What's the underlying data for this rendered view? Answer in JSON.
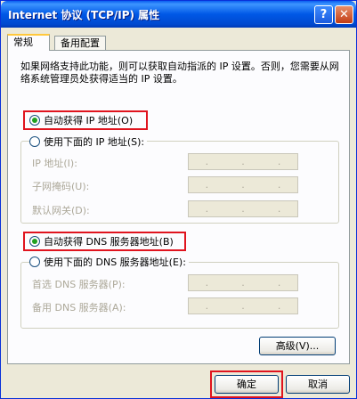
{
  "window": {
    "title": "Internet 协议 (TCP/IP) 属性",
    "help_glyph": "?",
    "close_glyph": "✕"
  },
  "tabs": [
    {
      "label": "常规",
      "active": true
    },
    {
      "label": "备用配置",
      "active": false
    }
  ],
  "description": "如果网络支持此功能，则可以获取自动指派的 IP 设置。否则，您需要从网络系统管理员处获得适当的 IP 设置。",
  "ip_section": {
    "auto_option": "自动获得 IP 地址(O)",
    "manual_option": "使用下面的 IP 地址(S):",
    "selected": "auto",
    "fields": [
      {
        "label": "IP 地址(I):"
      },
      {
        "label": "子网掩码(U):"
      },
      {
        "label": "默认网关(D):"
      }
    ]
  },
  "dns_section": {
    "auto_option": "自动获得 DNS 服务器地址(B)",
    "manual_option": "使用下面的 DNS 服务器地址(E):",
    "selected": "auto",
    "fields": [
      {
        "label": "首选 DNS 服务器(P):"
      },
      {
        "label": "备用 DNS 服务器(A):"
      }
    ]
  },
  "ip_dot": ".",
  "buttons": {
    "advanced": "高级(V)...",
    "ok": "确定",
    "cancel": "取消"
  },
  "colors": {
    "highlight": "#e0141e",
    "titlebar": "#0058e6",
    "dialog_bg": "#ece9d8"
  }
}
